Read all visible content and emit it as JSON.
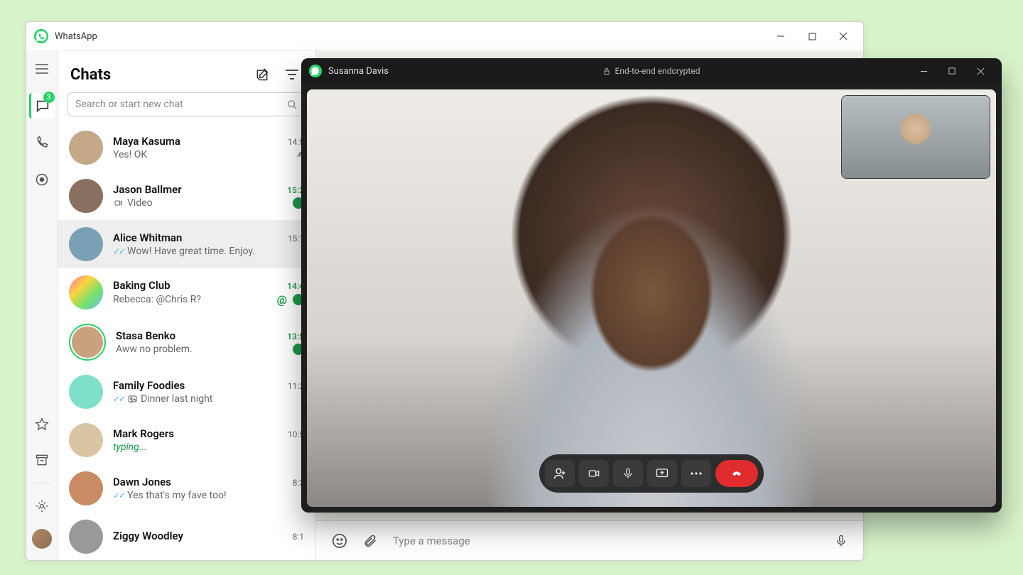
{
  "app": {
    "title": "WhatsApp"
  },
  "rail": {
    "chats_badge": "3"
  },
  "sidebar": {
    "title": "Chats",
    "search_placeholder": "Search or start new chat"
  },
  "chats": [
    {
      "name": "Maya Kasuma",
      "msg": "Yes! OK",
      "time": "14:5",
      "ticks": false,
      "typing": false,
      "unread": false,
      "pin": true,
      "av": "#c4a887"
    },
    {
      "name": "Jason Ballmer",
      "msg": "Video",
      "time": "15:2",
      "ticks": false,
      "typing": false,
      "unread": true,
      "video": true,
      "av": "#8a7060"
    },
    {
      "name": "Alice Whitman",
      "msg": "Wow! Have great time. Enjoy.",
      "time": "15:1",
      "ticks": true,
      "typing": false,
      "selected": true,
      "av": "#7aa0b5"
    },
    {
      "name": "Baking Club",
      "msg": "Rebecca: @Chris R?",
      "time": "14:4",
      "ticks": false,
      "typing": false,
      "unread": true,
      "mention": true,
      "av": "linear-gradient(135deg,#ff6fb5,#ffd23f,#6fe36f,#6fb5ff)"
    },
    {
      "name": "Stasa Benko",
      "msg": "Aww no problem.",
      "time": "13:5",
      "ticks": false,
      "typing": false,
      "unread": true,
      "ring": true,
      "av": "#c9a27d"
    },
    {
      "name": "Family Foodies",
      "msg": "Dinner last night",
      "time": "11:2",
      "ticks": true,
      "typing": false,
      "photo": true,
      "av": "#7fe0c9"
    },
    {
      "name": "Mark Rogers",
      "msg": "typing...",
      "time": "10:5",
      "ticks": false,
      "typing": true,
      "av": "#d9c5a3"
    },
    {
      "name": "Dawn Jones",
      "msg": "Yes that's my fave too!",
      "time": "8:3",
      "ticks": true,
      "typing": false,
      "av": "#c98b63"
    },
    {
      "name": "Ziggy Woodley",
      "msg": "",
      "time": "8:1",
      "av": "#999"
    }
  ],
  "composer": {
    "placeholder": "Type a message"
  },
  "call": {
    "name": "Susanna Davis",
    "encrypted": "End-to-end endcrypted"
  }
}
